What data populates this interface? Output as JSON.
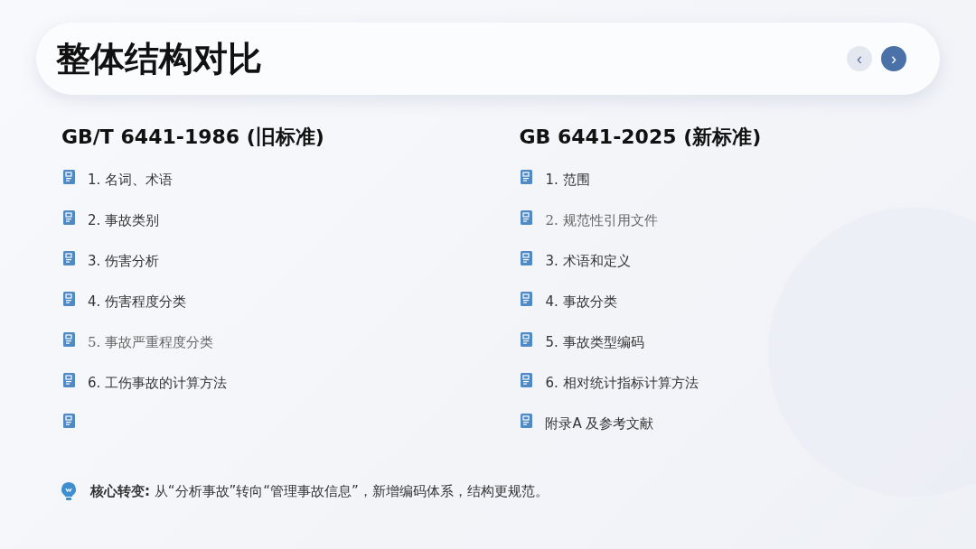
{
  "header": {
    "title": "整体结构对比",
    "nav": [
      {
        "label": "‹",
        "selected": false
      },
      {
        "label": "›",
        "selected": true
      }
    ]
  },
  "columns": [
    {
      "heading": "GB/T 6441-1986 (旧标准)",
      "items": [
        {
          "kind": "text",
          "text": "1. 名词、术语"
        },
        {
          "kind": "text",
          "text": "2. 事故类别"
        },
        {
          "kind": "text",
          "text": "3. 伤害分析"
        },
        {
          "kind": "text",
          "text": "4. 伤害程度分类"
        },
        {
          "kind": "serif",
          "text": "5.  事故严重程度分类"
        },
        {
          "kind": "text",
          "text": "6. 工伤事故的计算方法"
        },
        {
          "kind": "blank"
        }
      ]
    },
    {
      "heading": "GB 6441-2025 (新标准)",
      "items": [
        {
          "kind": "text",
          "text": "1. 范围"
        },
        {
          "kind": "serif",
          "text": "2.  规范性引用文件"
        },
        {
          "kind": "text",
          "text": "3. 术语和定义"
        },
        {
          "kind": "text",
          "text": "4. 事故分类"
        },
        {
          "kind": "text",
          "text": "5. 事故类型编码"
        },
        {
          "kind": "text",
          "text": "6. 相对统计指标计算方法"
        },
        {
          "kind": "text",
          "text": "附录A 及参考文献"
        }
      ]
    }
  ],
  "footer": {
    "text": "**核心转变:** 从“分析事故”转向“管理事故信息”，新增编码体系，结构更规范。"
  }
}
